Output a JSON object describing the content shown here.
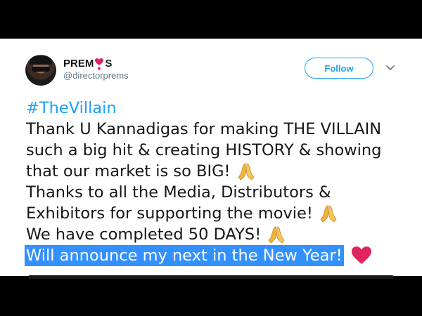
{
  "tweet": {
    "author": {
      "display_name_prefix": "PREM",
      "display_name_suffix": "S",
      "handle": "@directorprems",
      "avatar_icon": "profile-photo"
    },
    "follow_label": "Follow",
    "hashtag": "#TheVillain",
    "lines": [
      "Thank U Kannadigas for making THE VILLAIN",
      "such a big hit & creating HISTORY & showing",
      "that our market is so BIG!",
      "Thanks to all the Media, Distributors &",
      "Exhibitors for supporting the movie!",
      "We have completed 50 DAYS!",
      "Will announce my next in the New Year!"
    ],
    "icons": {
      "name_emoji": "heart-exclamation-icon",
      "pray": "folded-hands-icon",
      "heart": "red-heart-icon",
      "menu": "chevron-down-icon"
    },
    "colors": {
      "link": "#1da1f2",
      "selection": "#3390ff",
      "heart": "#e0245e",
      "text": "#14171a",
      "muted": "#657786"
    }
  }
}
